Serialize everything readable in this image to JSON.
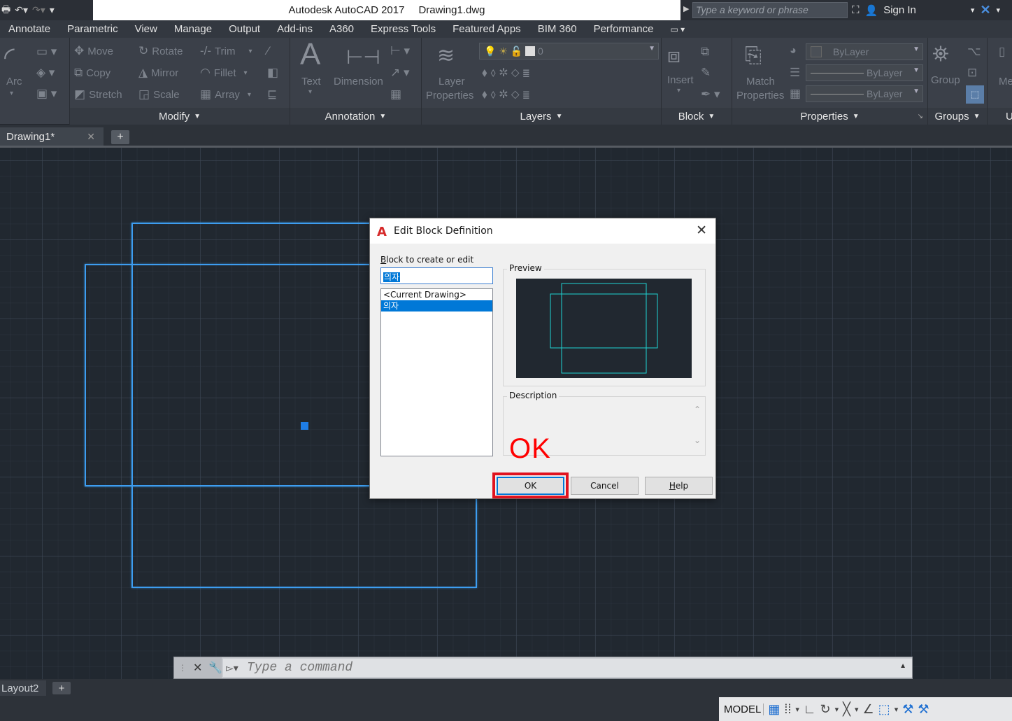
{
  "window": {
    "app_title": "Autodesk AutoCAD 2017",
    "file_name": "Drawing1.dwg",
    "search_placeholder": "Type a keyword or phrase",
    "sign_in": "Sign In"
  },
  "menu": [
    "Annotate",
    "Parametric",
    "View",
    "Manage",
    "Output",
    "Add-ins",
    "A360",
    "Express Tools",
    "Featured Apps",
    "BIM 360",
    "Performance"
  ],
  "ribbon": {
    "draw": {
      "arc": "Arc"
    },
    "modify": {
      "title": "Modify",
      "move": "Move",
      "rotate": "Rotate",
      "trim": "Trim",
      "copy": "Copy",
      "mirror": "Mirror",
      "fillet": "Fillet",
      "stretch": "Stretch",
      "scale": "Scale",
      "array": "Array"
    },
    "annotation": {
      "title": "Annotation",
      "text": "Text",
      "dimension": "Dimension"
    },
    "layers": {
      "title": "Layers",
      "layer_properties_line1": "Layer",
      "layer_properties_line2": "Properties",
      "current_layer": "0"
    },
    "block": {
      "title": "Block",
      "insert": "Insert"
    },
    "properties": {
      "title": "Properties",
      "match_line1": "Match",
      "match_line2": "Properties",
      "color": "ByLayer",
      "linetype": "ByLayer",
      "lineweight": "ByLayer"
    },
    "groups": {
      "title": "Groups",
      "group": "Group"
    },
    "cut_off": {
      "me": "Me",
      "u": "U"
    }
  },
  "tabs": {
    "document": "Drawing1*"
  },
  "dialog": {
    "title": "Edit Block Definition",
    "block_label_underlined": "B",
    "block_label_rest": "lock to create or edit",
    "block_name_value": "의자",
    "list_items": [
      "<Current Drawing>",
      "의자"
    ],
    "preview_label": "Preview",
    "description_label": "Description",
    "ok": "OK",
    "cancel": "Cancel",
    "help_underlined": "H",
    "help_rest": "elp"
  },
  "annotation_note": "OK",
  "command_line": {
    "placeholder": "Type a command"
  },
  "layout": {
    "tab": "Layout2"
  },
  "status": {
    "model": "MODEL"
  },
  "colors": {
    "accent_blue": "#0078d7",
    "selection_blue": "#3d9df0",
    "highlight_red": "#e0131f",
    "canvas_bg": "#212830",
    "preview_cyan": "#1fd3d3"
  }
}
